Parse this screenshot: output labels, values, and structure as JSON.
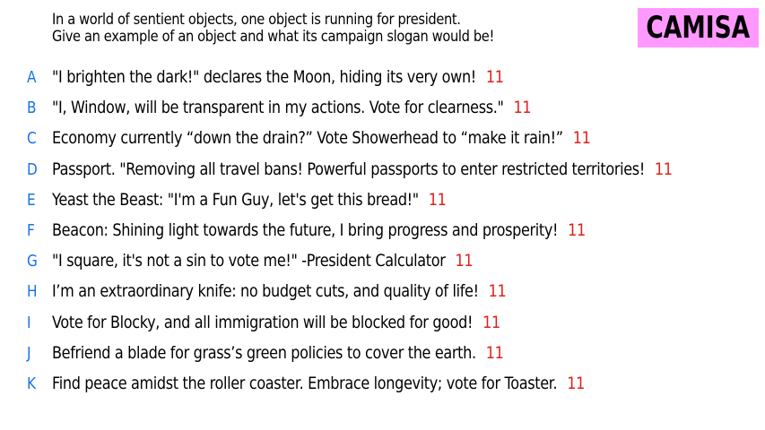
{
  "prompt": {
    "line1": "In a world of sentient objects, one object is running for president.",
    "line2": "Give an example of an object and what its campaign slogan would be!"
  },
  "badge": {
    "label": "CAMISA",
    "color": "#ff99ff"
  },
  "colors": {
    "letter": "#1a73e8",
    "votes": "#e0201a",
    "text": "#000000"
  },
  "answers": [
    {
      "letter": "A",
      "text": "\"I brighten the dark!\" declares the Moon, hiding its very own!",
      "votes": "11"
    },
    {
      "letter": "B",
      "text": "\"I, Window, will be transparent in my actions. Vote for clearness.\"",
      "votes": "11"
    },
    {
      "letter": "C",
      "text": "Economy currently “down the drain?” Vote Showerhead to “make it rain!”",
      "votes": "11"
    },
    {
      "letter": "D",
      "text": "Passport. \"Removing all travel bans! Powerful passports to enter restricted territories!",
      "votes": "11"
    },
    {
      "letter": "E",
      "text": "Yeast the Beast: \"I'm a Fun Guy, let's get this bread!\"",
      "votes": "11"
    },
    {
      "letter": "F",
      "text": "Beacon: Shining light towards the future, I bring progress and prosperity!",
      "votes": "11"
    },
    {
      "letter": "G",
      "text": "\"I square, it's not a sin to vote me!\" -President Calculator",
      "votes": "11"
    },
    {
      "letter": "H",
      "text": "I’m an extraordinary knife: no budget cuts, and quality of life!",
      "votes": "11"
    },
    {
      "letter": "I",
      "text": "Vote for Blocky, and all immigration will be blocked for good!",
      "votes": "11"
    },
    {
      "letter": "J",
      "text": "Befriend a blade for grass’s green policies to cover the earth.",
      "votes": "11"
    },
    {
      "letter": "K",
      "text": "Find peace amidst the roller coaster. Embrace longevity; vote for Toaster.",
      "votes": "11"
    }
  ]
}
